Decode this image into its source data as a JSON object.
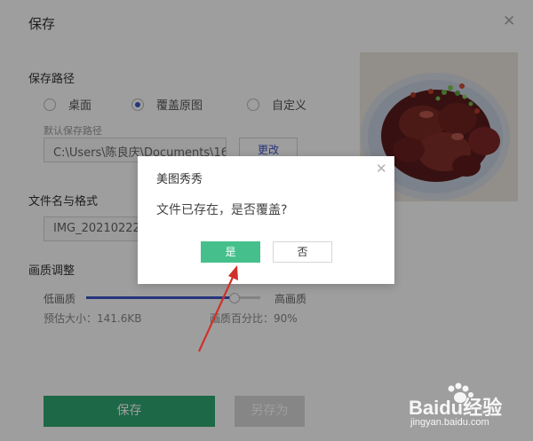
{
  "window": {
    "title": "保存"
  },
  "save_path": {
    "heading": "保存路径",
    "options": [
      "桌面",
      "覆盖原图",
      "自定义"
    ],
    "selected": "覆盖原图",
    "default_label": "默认保存路径",
    "path_value": "C:\\Users\\陈良庆\\Documents\\16\\",
    "change_label": "更改"
  },
  "filename": {
    "heading": "文件名与格式",
    "value": "IMG_20210222_1"
  },
  "quality": {
    "heading": "画质调整",
    "low_label": "低画质",
    "high_label": "高画质",
    "level": 0.85,
    "estimate_label": "预估大小：141.6KB",
    "percent_label": "画质百分比：90%"
  },
  "buttons": {
    "save": "保存",
    "save_as": "另存为"
  },
  "dialog": {
    "title": "美图秀秀",
    "message": "文件已存在，是否覆盖?",
    "yes": "是",
    "no": "否"
  },
  "watermark": {
    "brand": "Baidu经验",
    "url": "jingyan.baidu.com"
  },
  "colors": {
    "accent": "#3e56c8",
    "save_green": "#2fa872",
    "yes_green": "#45c08d"
  }
}
